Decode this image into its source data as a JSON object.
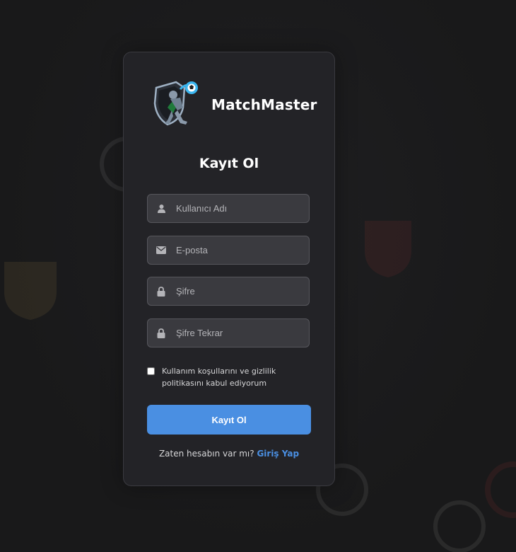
{
  "brand": {
    "name": "MatchMaster"
  },
  "form": {
    "title": "Kayıt Ol",
    "fields": [
      {
        "placeholder": "Kullanıcı Adı",
        "icon": "user-icon",
        "type": "text"
      },
      {
        "placeholder": "E-posta",
        "icon": "envelope-icon",
        "type": "email"
      },
      {
        "placeholder": "Şifre",
        "icon": "lock-icon",
        "type": "password"
      },
      {
        "placeholder": "Şifre Tekrar",
        "icon": "lock-icon",
        "type": "password"
      }
    ],
    "terms_label": "Kullanım koşullarını ve gizlilik politikasını kabul ediyorum",
    "submit_label": "Kayıt Ol",
    "login_prompt": "Zaten hesabın var mı?",
    "login_link": "Giriş Yap"
  },
  "colors": {
    "background": "#1b1b1d",
    "card": "#232327",
    "input": "#3a3a3f",
    "accent": "#4a8fe2"
  }
}
